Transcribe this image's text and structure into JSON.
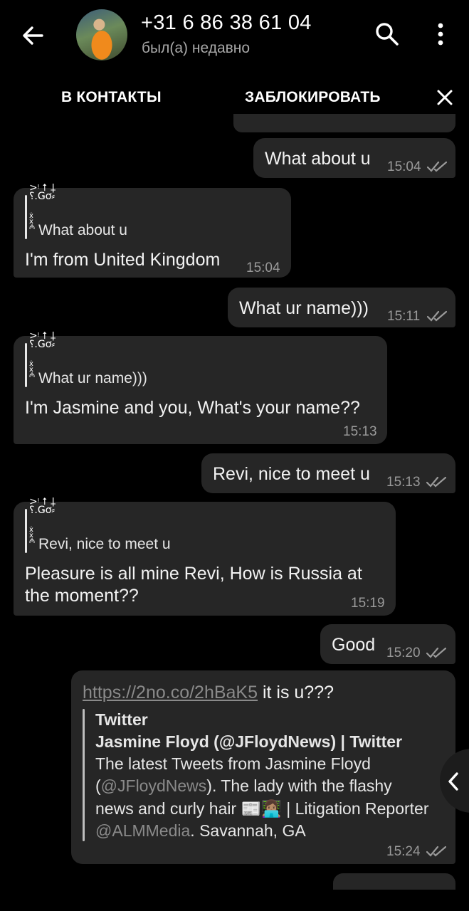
{
  "header": {
    "title": "+31 6 86 38 61 04",
    "status": "был(а) недавно"
  },
  "actions": {
    "add_contact": "В КОНТАКТЫ",
    "block": "ЗАБЛОКИРОВАТЬ"
  },
  "messages": [
    {
      "dir": "out",
      "text": "What about u",
      "time": "15:04"
    },
    {
      "dir": "in",
      "reply": "What about u",
      "text": "I'm from United Kingdom",
      "time": "15:04"
    },
    {
      "dir": "out",
      "text": "What ur name)))",
      "time": "15:11"
    },
    {
      "dir": "in",
      "reply": "What ur name)))",
      "text": "I'm Jasmine and you, What's your name??",
      "time": "15:13"
    },
    {
      "dir": "out",
      "text": "Revi, nice to meet u",
      "time": "15:13"
    },
    {
      "dir": "in",
      "reply": "Revi, nice to meet u",
      "text_line1": "Pleasure is all mine Revi, How is Russia at",
      "text_line2": "the moment??",
      "time": "15:19"
    },
    {
      "dir": "out",
      "text": "Good",
      "time": "15:20"
    },
    {
      "dir": "out",
      "link": "https://2no.co/2hBaK5",
      "text_after": " it is u???",
      "preview": {
        "site": "Twitter",
        "title": "Jasmine Floyd (@JFloydNews) | Twitter",
        "desc_line1": "The latest Tweets from Jasmine Floyd",
        "desc_line2_handle": "@JFloydNews",
        "desc_line2_rest": "). The lady with the flashy",
        "desc_line3": "news and curly hair 📰👩🏽‍💻 | Litigation Reporter",
        "desc_line4_handle": "@ALMMedia",
        "desc_line4_rest": ". Savannah, GA"
      },
      "time": "15:24"
    }
  ],
  "colors": {
    "bubble": "#262626",
    "background": "#000000",
    "time": "#9a9a9a"
  }
}
